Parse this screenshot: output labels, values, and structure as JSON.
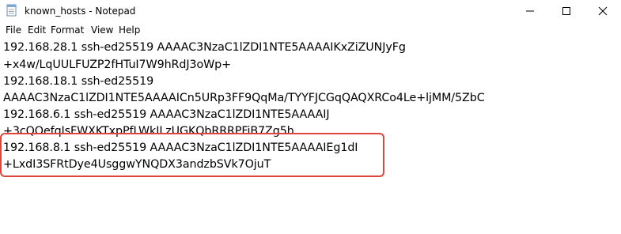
{
  "window": {
    "title": "known_hosts - Notepad"
  },
  "menu": {
    "items": [
      "File",
      "Edit",
      "Format",
      "View",
      "Help"
    ]
  },
  "editor": {
    "lines": [
      "192.168.28.1 ssh-ed25519 AAAAC3NzaC1lZDI1NTE5AAAAIKxZiZUNJyFg",
      "+x4w/LqUULFUZP2fHTuI7W9hRdJ3oWp+",
      "192.168.18.1 ssh-ed25519",
      "AAAAC3NzaC1lZDI1NTE5AAAAICn5URp3FF9QqMa/TYYFJCGqQAQXRCo4Le+ljMM/5ZbC",
      "192.168.6.1 ssh-ed25519 AAAAC3NzaC1lZDI1NTE5AAAAIJ",
      "+3cQOefqIsFWXKTxpPfLWkILzUGKQbRRRPFiB7Zg5h",
      "192.168.8.1 ssh-ed25519 AAAAC3NzaC1lZDI1NTE5AAAAIEg1dI",
      "+LxdI3SFRtDye4UsggwYNQDX3andzbSVk7OjuT"
    ]
  },
  "colors": {
    "highlight": "#e0443a"
  }
}
